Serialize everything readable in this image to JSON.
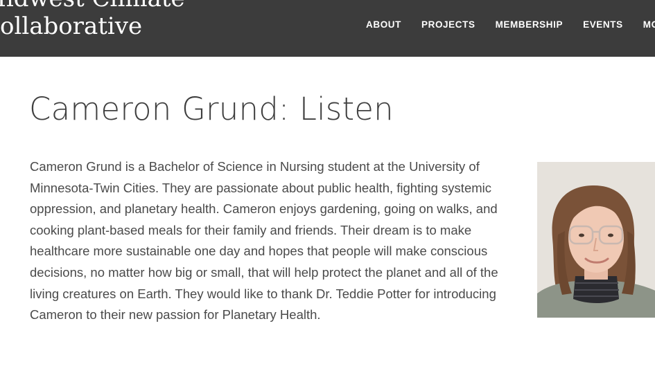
{
  "header": {
    "site_title_line1": "Midwest Climate",
    "site_title_line2": "Collaborative",
    "nav": [
      {
        "label": "ABOUT"
      },
      {
        "label": "PROJECTS"
      },
      {
        "label": "MEMBERSHIP"
      },
      {
        "label": "EVENTS"
      },
      {
        "label": "MORE"
      }
    ]
  },
  "main": {
    "title": "Cameron Grund: Listen",
    "bio": "Cameron Grund is a Bachelor of Science in Nursing student at the University of Minnesota-Twin Cities. They are passionate about public health, fighting systemic oppression, and planetary health. Cameron enjoys gardening, going on walks, and cooking plant-based meals for their family and friends. Their dream is to make healthcare more sustainable one day and hopes that people will make conscious decisions, no matter how big or small, that will help protect the planet and all of the living creatures on Earth. They would like to thank Dr. Teddie Potter for introducing Cameron to their new passion for Planetary Health."
  },
  "colors": {
    "header_bg": "#3c3c3c",
    "title_text": "#3f3f3f",
    "body_text": "#4a4a4a"
  }
}
